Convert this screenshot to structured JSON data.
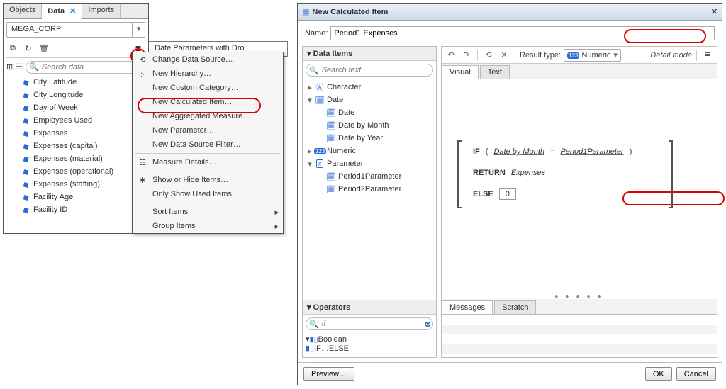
{
  "left": {
    "tabs": {
      "objects": "Objects",
      "data": "Data",
      "imports": "Imports"
    },
    "datasource": "MEGA_CORP",
    "search_placeholder": "Search data",
    "header_strip": "Date Parameters with Dro",
    "items": [
      "City Latitude",
      "City Longitude",
      "Day of Week",
      "Employees Used",
      "Expenses",
      "Expenses (capital)",
      "Expenses (material)",
      "Expenses (operational)",
      "Expenses (staffing)",
      "Facility Age",
      "Facility ID"
    ]
  },
  "menu": {
    "change_ds": "Change Data Source…",
    "new_hier": "New Hierarchy…",
    "new_cat": "New Custom Category…",
    "new_calc": "New Calculated Item…",
    "new_agg": "New Aggregated Measure…",
    "new_param": "New Parameter…",
    "new_filter": "New Data Source Filter…",
    "measure": "Measure Details…",
    "showhide": "Show or Hide Items…",
    "onlyused": "Only Show Used Items",
    "sort": "Sort Items",
    "group": "Group Items"
  },
  "dialog": {
    "title": "New Calculated Item",
    "name_label": "Name:",
    "name_value": "Period1 Expenses",
    "data_items_hdr": "Data Items",
    "search_placeholder": "Search text",
    "tree": {
      "character": "Character",
      "date": "Date",
      "date_item": "Date",
      "date_month": "Date by Month",
      "date_year": "Date by Year",
      "numeric": "Numeric",
      "parameter": "Parameter",
      "p1": "Period1Parameter",
      "p2": "Period2Parameter"
    },
    "operators_hdr": "Operators",
    "op_search": "if",
    "boolean": "Boolean",
    "ifelse": "IF…ELSE",
    "result_label": "Result type:",
    "result_value": "Numeric",
    "detail_mode": "Detail mode",
    "tabs": {
      "visual": "Visual",
      "text": "Text"
    },
    "expr": {
      "if": "IF",
      "lp": "(",
      "rp": ")",
      "dbm": "Date by Month",
      "eq": "=",
      "p1": "Period1Parameter",
      "return": "RETURN",
      "expenses": "Expenses",
      "else": "ELSE",
      "zero": "0"
    },
    "msg_tabs": {
      "messages": "Messages",
      "scratch": "Scratch"
    },
    "footer": {
      "preview": "Preview…",
      "ok": "OK",
      "cancel": "Cancel"
    }
  }
}
